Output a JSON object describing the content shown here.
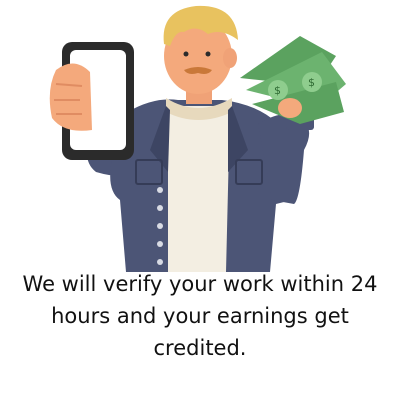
{
  "illustration": {
    "icon": "man-holding-phone-and-cash-icon",
    "colors": {
      "jacket": "#4c5576",
      "shirt": "#f3eee2",
      "sweater": "#e7d9bd",
      "skin": "#f4a97c",
      "hair": "#e8c25f",
      "money": "#6cb36f",
      "phone": "#2b2b2b"
    }
  },
  "message": {
    "line1": "We will verify your work within 24",
    "line2": "hours and your earnings get",
    "line3": "credited."
  }
}
